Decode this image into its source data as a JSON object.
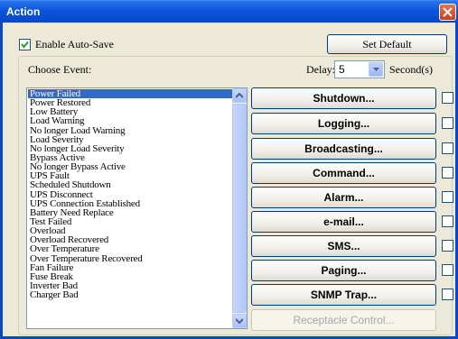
{
  "window": {
    "title": "Action"
  },
  "auto_save": {
    "label": "Enable Auto-Save",
    "checked": true
  },
  "set_default": {
    "label": "Set Default"
  },
  "choose_event": {
    "label": "Choose Event:"
  },
  "delay": {
    "label": "Delay:",
    "value": "5",
    "unit": "Second(s)"
  },
  "events": [
    "Power Failed",
    "Power Restored",
    "Low Battery",
    "Load Warning",
    "No longer Load Warning",
    "Load Severity",
    "No longer Load Severity",
    "Bypass Active",
    "No longer Bypass Active",
    "UPS Fault",
    "Scheduled Shutdown",
    "UPS Disconnect",
    "UPS Connection Established",
    "Battery Need Replace",
    "Test Failed",
    "Overload",
    "Overload Recovered",
    "Over Temperature",
    "Over Temperature Recovered",
    "Fan Failure",
    "Fuse Break",
    "Inverter Bad",
    "Charger Bad"
  ],
  "selected_event": "Power Failed",
  "actions": [
    {
      "label": "Shutdown...",
      "status": "check",
      "enabled": true,
      "checked": false
    },
    {
      "label": "Logging...",
      "status": "check",
      "enabled": true,
      "checked": false
    },
    {
      "label": "Broadcasting...",
      "status": "cross",
      "enabled": true,
      "checked": false
    },
    {
      "label": "Command...",
      "status": "check",
      "enabled": true,
      "checked": false
    },
    {
      "label": "Alarm...",
      "status": "check",
      "enabled": true,
      "checked": false
    },
    {
      "label": "e-mail...",
      "status": "check",
      "enabled": true,
      "checked": false
    },
    {
      "label": "SMS...",
      "status": "check",
      "enabled": true,
      "checked": false
    },
    {
      "label": "Paging...",
      "status": "cross",
      "enabled": true,
      "checked": false
    },
    {
      "label": "SNMP Trap...",
      "status": "cross",
      "enabled": true,
      "checked": false
    },
    {
      "label": "Receptacle Control...",
      "status": "none",
      "enabled": false,
      "checked": false
    }
  ],
  "colors": {
    "titlebar": "#0a54dc",
    "selection": "#316ac5",
    "check_icon": "#1f9a1f",
    "cross_icon": "#c0201a",
    "disabled_text": "#a7a6aa"
  }
}
